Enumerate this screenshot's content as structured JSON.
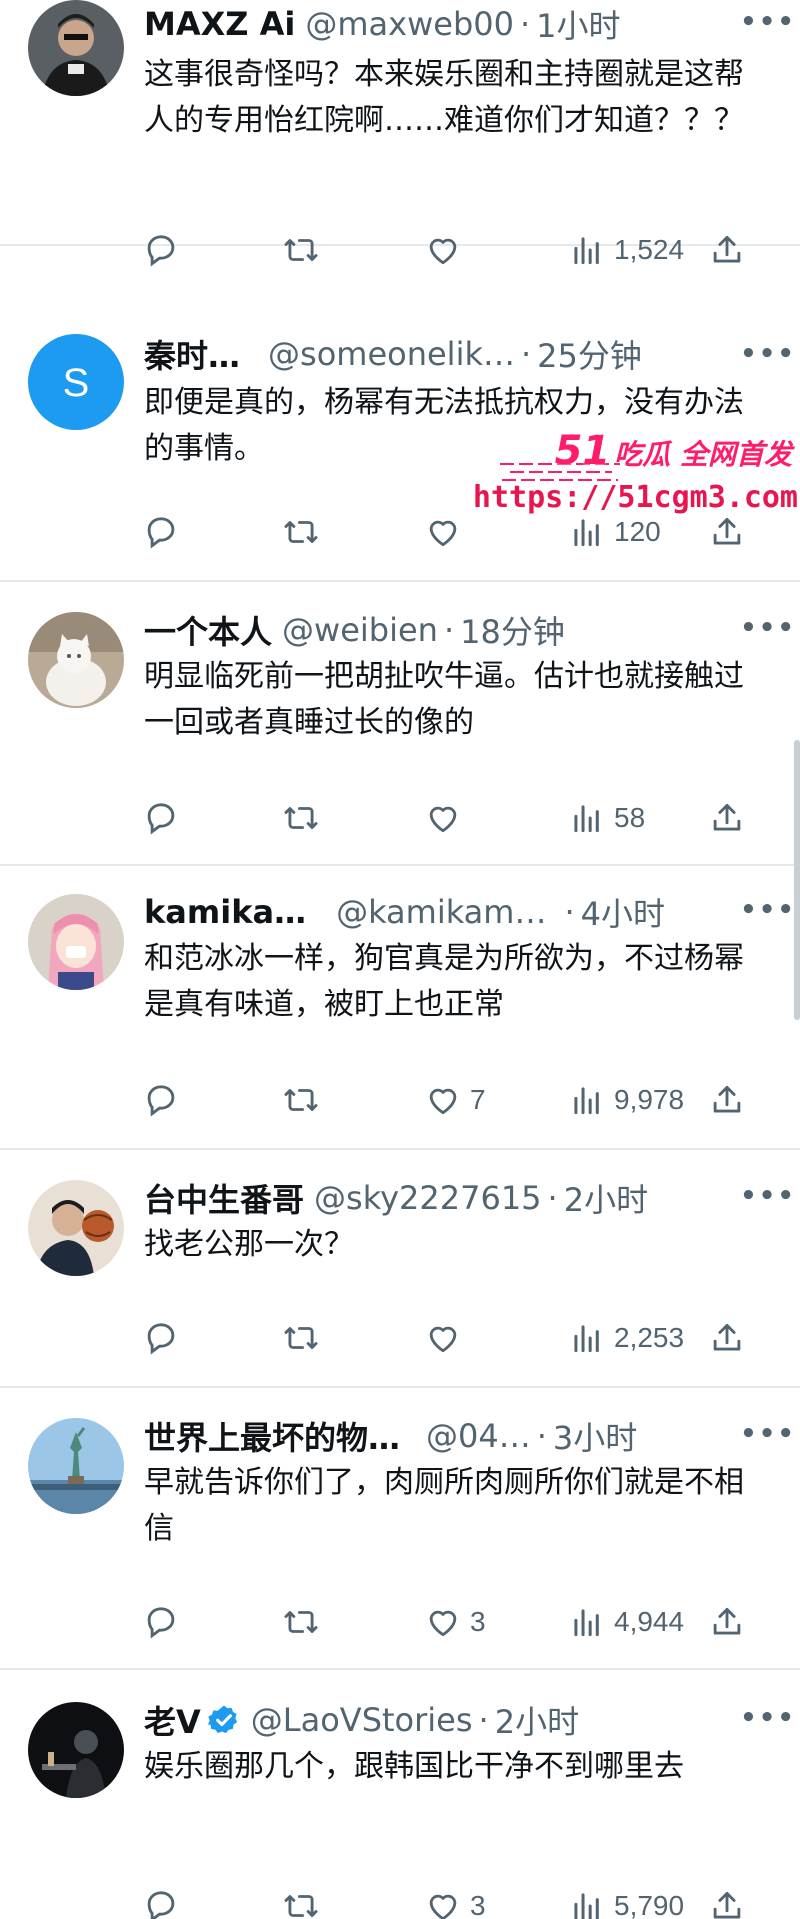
{
  "colors": {
    "text": "#0f1419",
    "secondary": "#536471",
    "divider": "#e6e9eb",
    "verified": "#1d9bf0",
    "watermark": "#ff1d6b"
  },
  "icons": [
    "reply-icon",
    "retweet-icon",
    "like-icon",
    "views-icon",
    "share-icon",
    "more-icon",
    "verified-icon"
  ],
  "posts": [
    {
      "display_name": "MAXZ Ai",
      "handle": "@maxweb00",
      "separator": "·",
      "time": "1小时",
      "text": "这事很奇怪吗？本来娱乐圈和主持圈就是这帮人的专用怡红院啊……难道你们才知道？？？",
      "views": "1,524",
      "likes": "",
      "verified": false
    },
    {
      "display_name": "秦时…",
      "handle": "@someonelik…",
      "separator": "·",
      "time": "25分钟",
      "text": "即便是真的，杨幂有无法抵抗权力，没有办法的事情。",
      "views": "120",
      "likes": "",
      "avatar_letter": "S",
      "verified": false
    },
    {
      "display_name": "一个本人",
      "handle": "@weibien",
      "separator": "·",
      "time": "18分钟",
      "text": "明显临死前一把胡扯吹牛逼。估计也就接触过一回或者真睡过长的像的",
      "views": "58",
      "likes": "",
      "verified": false
    },
    {
      "display_name": "kamika…",
      "handle": "@kamikam…",
      "separator": "·",
      "time": "4小时",
      "text": "和范冰冰一样，狗官真是为所欲为，不过杨幂是真有味道，被盯上也正常",
      "views": "9,978",
      "likes": "7",
      "verified": false
    },
    {
      "display_name": "台中生番哥",
      "handle": "@sky2227615",
      "separator": "·",
      "time": "2小时",
      "text": "找老公那一次？",
      "views": "2,253",
      "likes": "",
      "verified": false
    },
    {
      "display_name": "世界上最坏的物…",
      "handle": "@04…",
      "separator": "·",
      "time": "3小时",
      "text": "早就告诉你们了，肉厕所肉厕所你们就是不相信",
      "views": "4,944",
      "likes": "3",
      "verified": false
    },
    {
      "display_name": "老V",
      "handle": "@LaoVStories",
      "separator": "·",
      "time": "2小时",
      "text": "娱乐圈那几个，跟韩国比干净不到哪里去",
      "views": "5,790",
      "likes": "3",
      "verified": true
    }
  ],
  "watermark": {
    "brand_number": "51",
    "brand_text": "吃瓜 全网首发",
    "url": "https://51cgm3.com"
  }
}
